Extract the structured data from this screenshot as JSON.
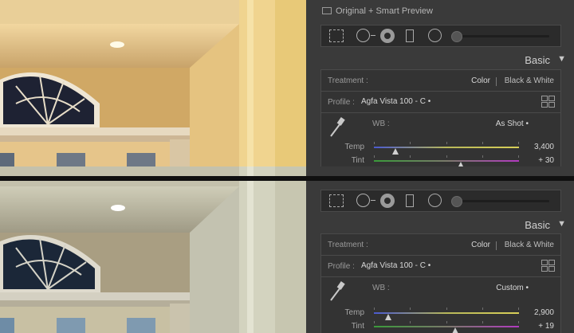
{
  "panel_top": {
    "status_text": "Original + Smart Preview",
    "section_title": "Basic",
    "treatment_label": "Treatment :",
    "treatment_color": "Color",
    "treatment_bw": "Black & White",
    "profile_label": "Profile :",
    "profile_value": "Agfa Vista 100 - C •",
    "wb_label": "WB :",
    "wb_value": "As Shot •",
    "temp_label": "Temp",
    "temp_value": "3,400",
    "temp_level": 0.15,
    "tint_label": "Tint",
    "tint_value": "+ 30",
    "tint_level": 0.6
  },
  "panel_bottom": {
    "section_title": "Basic",
    "treatment_label": "Treatment :",
    "treatment_color": "Color",
    "treatment_bw": "Black & White",
    "profile_label": "Profile :",
    "profile_value": "Agfa Vista 100 - C •",
    "wb_label": "WB :",
    "wb_value": "Custom •",
    "temp_label": "Temp",
    "temp_value": "2,900",
    "temp_level": 0.1,
    "tint_label": "Tint",
    "tint_value": "+ 19",
    "tint_level": 0.56
  },
  "icons": [
    "crop-overlay-icon",
    "spot-removal-icon",
    "red-eye-icon",
    "graduated-filter-icon",
    "radial-filter-icon",
    "adjustment-brush-icon",
    "profile-browser-icon",
    "white-balance-selector-icon",
    "collapse-arrow-icon"
  ],
  "colors": {
    "panel_bg": "#3a3a3a",
    "warm_photo_wall": "#e7c784",
    "cool_photo_wall": "#c9c9b8"
  }
}
